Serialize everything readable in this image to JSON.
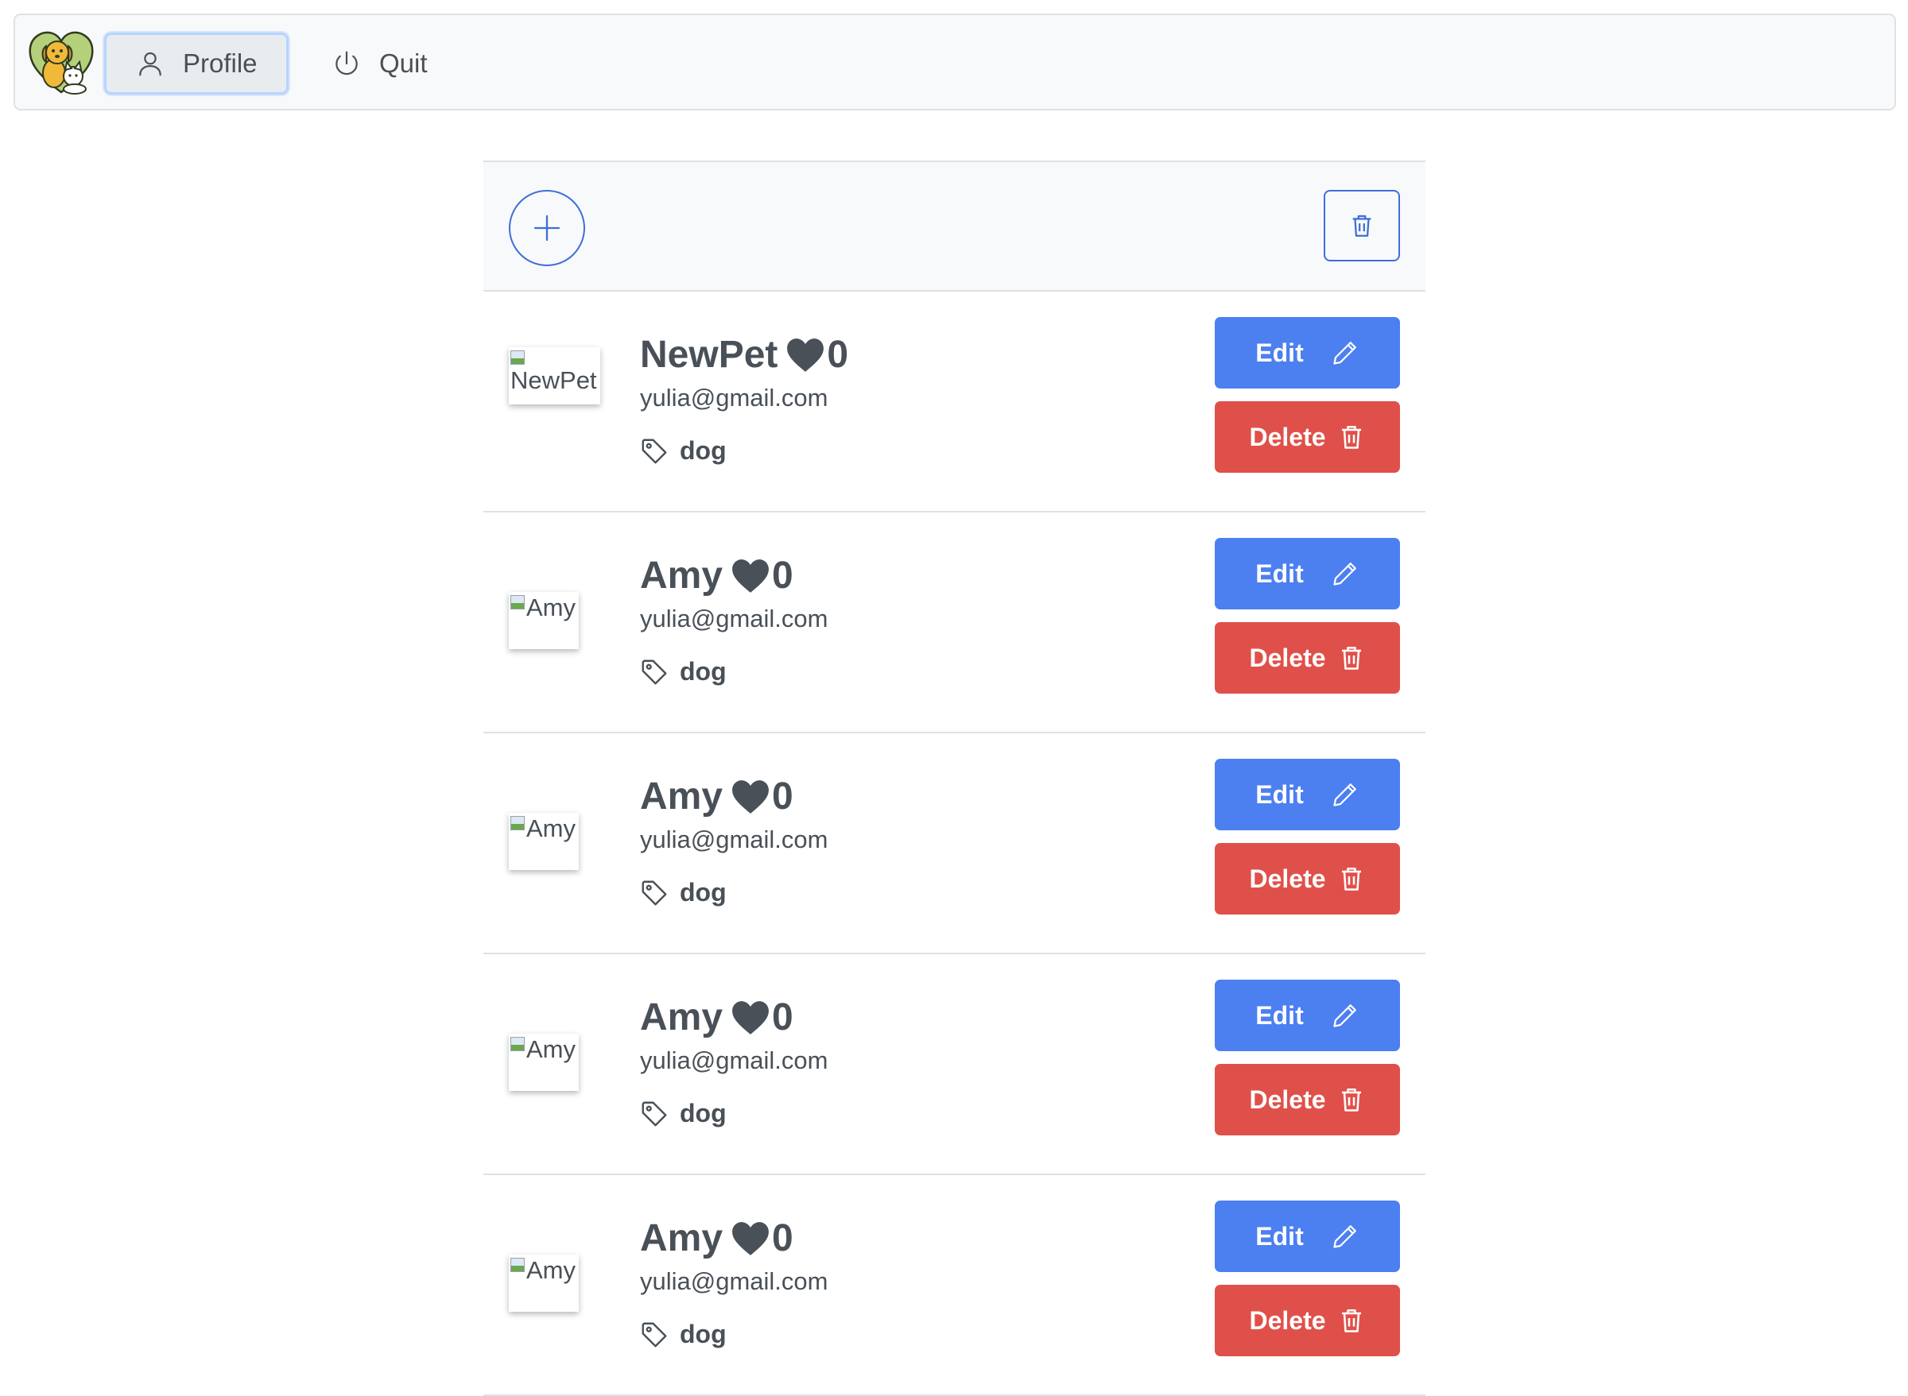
{
  "navbar": {
    "logo_icon": "pet-logo-icon",
    "profile_label": "Profile",
    "profile_icon": "user-icon",
    "quit_label": "Quit",
    "quit_icon": "power-icon"
  },
  "toolbar": {
    "add_icon": "plus-icon",
    "delete_all_icon": "trash-icon",
    "accent_color": "#3d6fd8"
  },
  "pets": [
    {
      "name": "NewPet",
      "likes": "0",
      "owner_email": "yulia@gmail.com",
      "tag": "dog",
      "image_alt": "NewPet",
      "edit_label": "Edit",
      "delete_label": "Delete"
    },
    {
      "name": "Amy",
      "likes": "0",
      "owner_email": "yulia@gmail.com",
      "tag": "dog",
      "image_alt": "Amy",
      "edit_label": "Edit",
      "delete_label": "Delete"
    },
    {
      "name": "Amy",
      "likes": "0",
      "owner_email": "yulia@gmail.com",
      "tag": "dog",
      "image_alt": "Amy",
      "edit_label": "Edit",
      "delete_label": "Delete"
    },
    {
      "name": "Amy",
      "likes": "0",
      "owner_email": "yulia@gmail.com",
      "tag": "dog",
      "image_alt": "Amy",
      "edit_label": "Edit",
      "delete_label": "Delete"
    },
    {
      "name": "Amy",
      "likes": "0",
      "owner_email": "yulia@gmail.com",
      "tag": "dog",
      "image_alt": "Amy",
      "edit_label": "Edit",
      "delete_label": "Delete"
    }
  ],
  "colors": {
    "edit_button": "#4c7ff0",
    "delete_button": "#e0504a",
    "text": "#495057"
  }
}
